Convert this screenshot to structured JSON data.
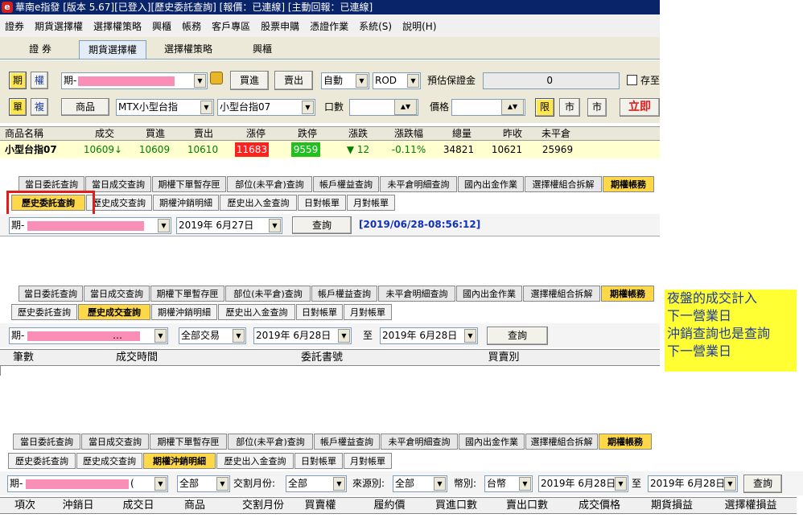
{
  "titlebar": {
    "title": "華南e指發 [版本 5.67][已登入][歷史委託查詢] [報價：已連線] [主動回報：已連線]"
  },
  "menu": [
    "證券",
    "期貨選擇權",
    "選擇權策略",
    "興櫃",
    "帳務",
    "客戶專區",
    "股票申購",
    "憑證作業",
    "系統(S)",
    "說明(H)"
  ],
  "top_tabs": [
    "證 券",
    "期貨選擇權",
    "選擇權策略",
    "興櫃"
  ],
  "order_panel": {
    "btn_futures": "期",
    "btn_options": "權",
    "account_prefix": "期-",
    "btn_buy": "買進",
    "btn_sell": "賣出",
    "mode_value": "自動",
    "condition_value": "ROD",
    "margin_label": "預估保證金",
    "margin_value": "0",
    "save_label": "存至",
    "btn_single": "單",
    "btn_multi": "複",
    "btn_product": "商品",
    "product_value": "MTX小型台指",
    "contract_value": "小型台指07",
    "qty_label": "口數",
    "price_label": "價格",
    "btn_limit": "限",
    "btn_market": "市",
    "btn_market2": "市",
    "btn_order_now": "立即"
  },
  "quote": {
    "headers": [
      "商品名稱",
      "成交",
      "買進",
      "賣出",
      "漲停",
      "跌停",
      "漲跌",
      "漲跌幅",
      "總量",
      "昨收",
      "未平倉"
    ],
    "row": {
      "name": "小型台指07",
      "last": "10609↓",
      "bid": "10609",
      "ask": "10610",
      "limit_up": "11683",
      "limit_down": "9559",
      "change": "▼ 12",
      "change_pct": "-0.11%",
      "volume": "34821",
      "prev_close": "10621",
      "open_interest": "25969"
    }
  },
  "main_tabs": [
    "當日委託查詢",
    "當日成交查詢",
    "期權下單暫存匣",
    "部位(未平倉)查詢",
    "帳戶權益查詢",
    "未平倉明細查詢",
    "國內出金作業",
    "選擇權組合拆解",
    "期權帳務"
  ],
  "sub_tabs": [
    "歷史委託查詢",
    "歷史成交查詢",
    "期權沖銷明細",
    "歷史出入金查詢",
    "日對帳單",
    "月對帳單"
  ],
  "section1": {
    "account_prefix": "期-",
    "date_value": "2019年  6月27日",
    "query_button": "查詢",
    "timestamp": "[2019/06/28-08:56:12]"
  },
  "section2": {
    "account_prefix": "期-",
    "account_suffix": "…",
    "trade_type": "全部交易",
    "date_from": "2019年  6月28日",
    "to_label": "至",
    "date_to": "2019年  6月28日",
    "query_button": "查詢",
    "columns": [
      "筆數",
      "成交時間",
      "委託書號",
      "買賣別"
    ]
  },
  "section3": {
    "account_prefix": "期-",
    "account_suffix": "(",
    "filter_all": "全部",
    "month_label": "交割月份:",
    "month_value": "全部",
    "source_label": "來源別:",
    "source_value": "全部",
    "currency_label": "幣別:",
    "currency_value": "台幣",
    "date_from": "2019年  6月28日",
    "to_label": "至",
    "date_to": "2019年  6月28日",
    "query_button": "查詢",
    "columns": [
      "項次",
      "沖銷日",
      "成交日",
      "商品",
      "交割月份",
      "買賣權",
      "履約價",
      "買進口數",
      "賣出口數",
      "成交價格",
      "期貨損益",
      "選擇權損益"
    ]
  },
  "annotation": {
    "line1": "夜盤的成交計入",
    "line2": "下一營業日",
    "line3": "沖銷查詢也是查詢",
    "line4": "下一營業日"
  },
  "colors": {
    "accent": "#ffd84a",
    "limit_up": "#ff2020",
    "limit_down": "#20c020",
    "highlight": "#e21b1b",
    "annotation_bg": "#ffff33",
    "annotation_text": "#1e3aa0",
    "timestamp": "#1030c0",
    "up": "#008000"
  }
}
